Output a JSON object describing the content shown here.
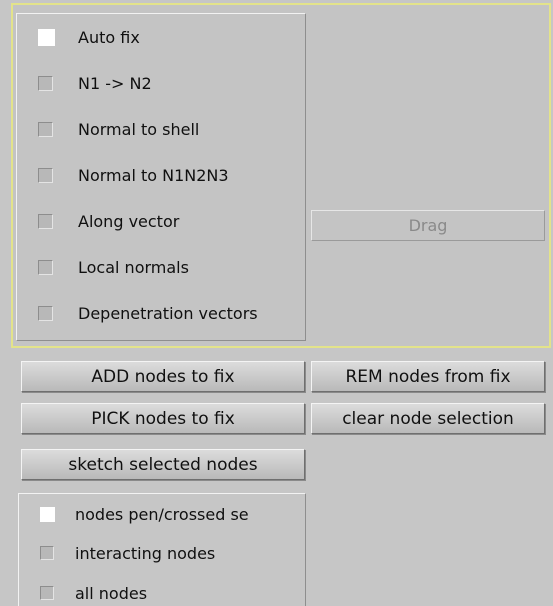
{
  "options": {
    "items": [
      {
        "label": "Auto fix",
        "checked": true
      },
      {
        "label": "N1 -> N2",
        "checked": false
      },
      {
        "label": "Normal to shell",
        "checked": false
      },
      {
        "label": "Normal to N1N2N3",
        "checked": false
      },
      {
        "label": "Along vector",
        "checked": false
      },
      {
        "label": "Local normals",
        "checked": false
      },
      {
        "label": "Depenetration vectors",
        "checked": false
      }
    ]
  },
  "drag": {
    "label": "Drag",
    "enabled": false
  },
  "buttons": {
    "add_nodes": "ADD nodes to fix",
    "rem_nodes": "REM nodes from fix",
    "pick_nodes": "PICK nodes to fix",
    "clear_selection": "clear node selection",
    "sketch_selected": "sketch selected nodes"
  },
  "node_display": {
    "items": [
      {
        "label": "nodes pen/crossed se",
        "checked": true
      },
      {
        "label": "interacting nodes",
        "checked": false
      },
      {
        "label": "all nodes",
        "checked": false
      }
    ]
  },
  "colors": {
    "background": "#c6c6c6",
    "frame_highlight": "#e3e38a",
    "checkbox_checked": "#ffffff",
    "disabled_text": "#8a8a8a"
  }
}
